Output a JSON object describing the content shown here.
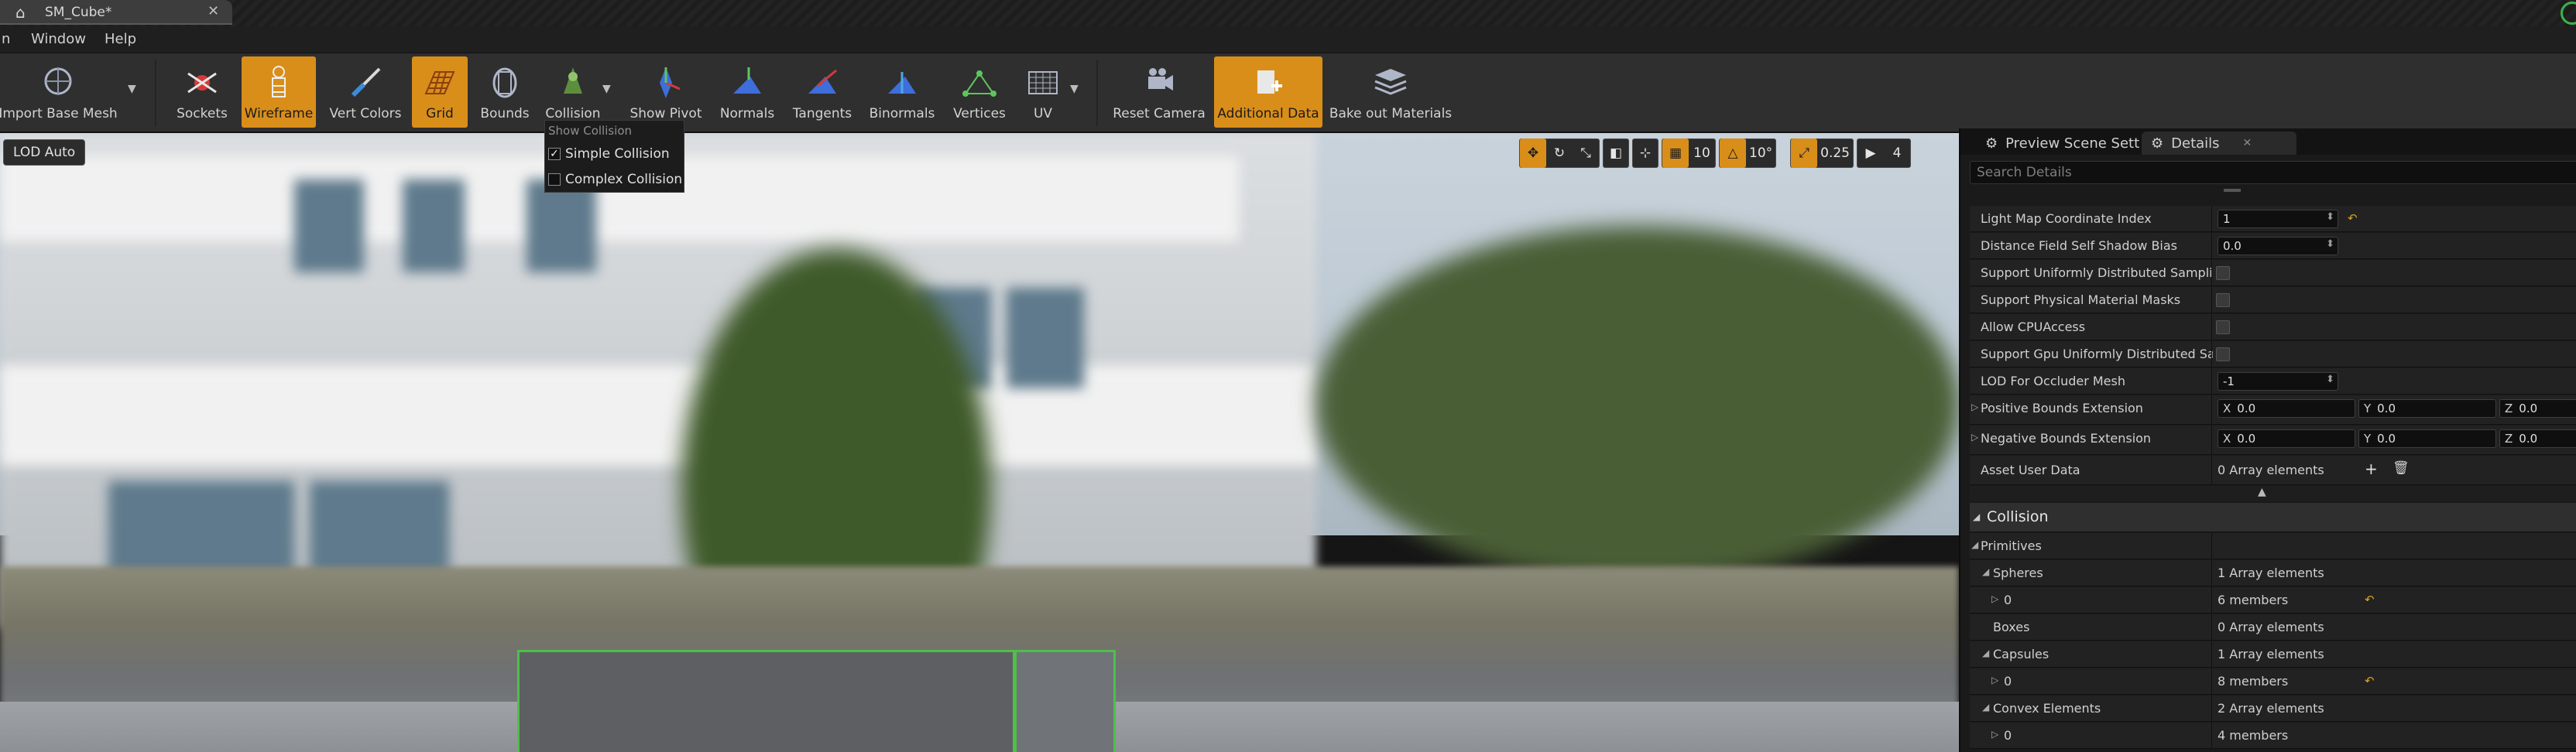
{
  "titlebar": {
    "tab_title": "SM_Cube*",
    "close": "✕"
  },
  "menu": {
    "items": [
      "n",
      "Window",
      "Help"
    ]
  },
  "toolbar": {
    "items": [
      {
        "label": "Import Base Mesh",
        "active": false
      },
      {
        "label": "Sockets",
        "active": false
      },
      {
        "label": "Wireframe",
        "active": true
      },
      {
        "label": "Vert Colors",
        "active": false
      },
      {
        "label": "Grid",
        "active": true
      },
      {
        "label": "Bounds",
        "active": false
      },
      {
        "label": "Collision",
        "active": false
      },
      {
        "label": "Show Pivot",
        "active": false
      },
      {
        "label": "Normals",
        "active": false
      },
      {
        "label": "Tangents",
        "active": false
      },
      {
        "label": "Binormals",
        "active": false
      },
      {
        "label": "Vertices",
        "active": false
      },
      {
        "label": "UV",
        "active": false
      },
      {
        "label": "Reset Camera",
        "active": false
      },
      {
        "label": "Additional Data",
        "active": true
      },
      {
        "label": "Bake out Materials",
        "active": false
      }
    ]
  },
  "viewport": {
    "lod_button": "LOD Auto",
    "grid_snap": "10",
    "rotation_snap": "10°",
    "scale_snap": "0.25",
    "camera_speed": "4"
  },
  "collision_menu": {
    "header": "Show Collision",
    "simple": "Simple Collision",
    "simple_checked": true,
    "complex": "Complex Collision",
    "complex_checked": false
  },
  "panel": {
    "tab_preview": "Preview Scene Sett",
    "tab_details": "Details",
    "search_placeholder": "Search Details",
    "rows": {
      "lightmap_index": {
        "label": "Light Map Coordinate Index",
        "value": "1"
      },
      "df_shadow_bias": {
        "label": "Distance Field Self Shadow Bias",
        "value": "0.0"
      },
      "support_uniform": {
        "label": "Support Uniformly Distributed Sampling"
      },
      "support_phys": {
        "label": "Support Physical Material Masks"
      },
      "allow_cpu": {
        "label": "Allow CPUAccess"
      },
      "support_gpu": {
        "label": "Support Gpu Uniformly Distributed Sampli"
      },
      "lod_occluder": {
        "label": "LOD For Occluder Mesh",
        "value": "-1"
      },
      "pos_bounds": {
        "label": "Positive Bounds Extension",
        "x_label": "X",
        "x": "0.0",
        "y_label": "Y",
        "y": "0.0",
        "z_label": "Z",
        "z": "0.0"
      },
      "neg_bounds": {
        "label": "Negative Bounds Extension",
        "x_label": "X",
        "x": "0.0",
        "y_label": "Y",
        "y": "0.0",
        "z_label": "Z",
        "z": "0.0"
      },
      "user_data": {
        "label": "Asset User Data",
        "value": "0 Array elements"
      }
    },
    "collision": {
      "section": "Collision",
      "primitives": "Primitives",
      "spheres": {
        "label": "Spheres",
        "value": "1 Array elements"
      },
      "spheres_0": {
        "label": "0",
        "value": "6 members"
      },
      "boxes": {
        "label": "Boxes",
        "value": "0 Array elements"
      },
      "capsules": {
        "label": "Capsules",
        "value": "1 Array elements"
      },
      "capsules_0": {
        "label": "0",
        "value": "8 members"
      },
      "convex": {
        "label": "Convex Elements",
        "value": "2 Array elements"
      },
      "convex_0": {
        "label": "0",
        "value": "4 members"
      }
    }
  },
  "colors": {
    "accent": "#d98e1a",
    "selection": "#4fbf4a",
    "reset_arrow": "#d9a11b"
  }
}
